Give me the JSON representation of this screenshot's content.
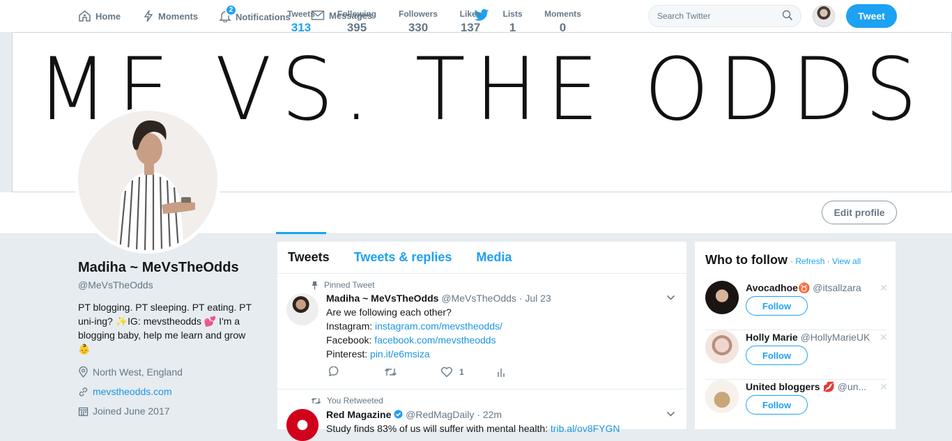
{
  "nav": {
    "home": "Home",
    "moments": "Moments",
    "notifications": "Notifications",
    "notifications_count": "2",
    "messages": "Messages"
  },
  "search": {
    "placeholder": "Search Twitter"
  },
  "tweet_button": "Tweet",
  "banner_text": "ME VS. THE ODDS",
  "stats": [
    {
      "label": "Tweets",
      "value": "313"
    },
    {
      "label": "Following",
      "value": "395"
    },
    {
      "label": "Followers",
      "value": "330"
    },
    {
      "label": "Likes",
      "value": "137"
    },
    {
      "label": "Lists",
      "value": "1"
    },
    {
      "label": "Moments",
      "value": "0"
    }
  ],
  "edit_profile": "Edit profile",
  "profile": {
    "name": "Madiha ~ MeVsTheOdds",
    "handle": "@MeVsTheOdds",
    "bio": "PT blogging. PT sleeping. PT eating. PT uni-ing? ✨IG: mevstheodds 💕 I'm a blogging baby, help me learn and grow 👶",
    "location": "North West, England",
    "website": "mevstheodds.com",
    "joined": "Joined June 2017"
  },
  "tabs": [
    "Tweets",
    "Tweets & replies",
    "Media"
  ],
  "tweets": [
    {
      "context": "Pinned Tweet",
      "name": "Madiha ~ MeVsTheOdds",
      "handle": "@MeVsTheOdds",
      "time": "Jul 23",
      "line1": "Are we following each other?",
      "line2_label": "Instagram: ",
      "line2_link": "instagram.com/mevstheodds/",
      "line3_label": "Facebook: ",
      "line3_link": "facebook.com/mevstheodds",
      "line4_label": "Pinterest: ",
      "line4_link": "pin.it/e6msiza",
      "likes": "1"
    },
    {
      "context": "You Retweeted",
      "name": "Red Magazine",
      "handle": "@RedMagDaily",
      "time": "22m",
      "line1_start": "Study finds 83% of us will suffer with mental health: ",
      "line1_link": "trib.al/ov8FYGN"
    }
  ],
  "who_to_follow": {
    "title": "Who to follow",
    "refresh": "Refresh",
    "view_all": "View all",
    "users": [
      {
        "name": "Avocadhoe♉",
        "handle": "@itsallzara",
        "follow": "Follow"
      },
      {
        "name": "Holly Marie",
        "handle": "@HollyMarieUK",
        "follow": "Follow"
      },
      {
        "name": "United bloggers 💋",
        "handle": "@un...",
        "follow": "Follow"
      }
    ]
  },
  "colors": {
    "accent": "#1da1f2",
    "background": "#e6ecf0",
    "text_secondary": "#657786"
  }
}
